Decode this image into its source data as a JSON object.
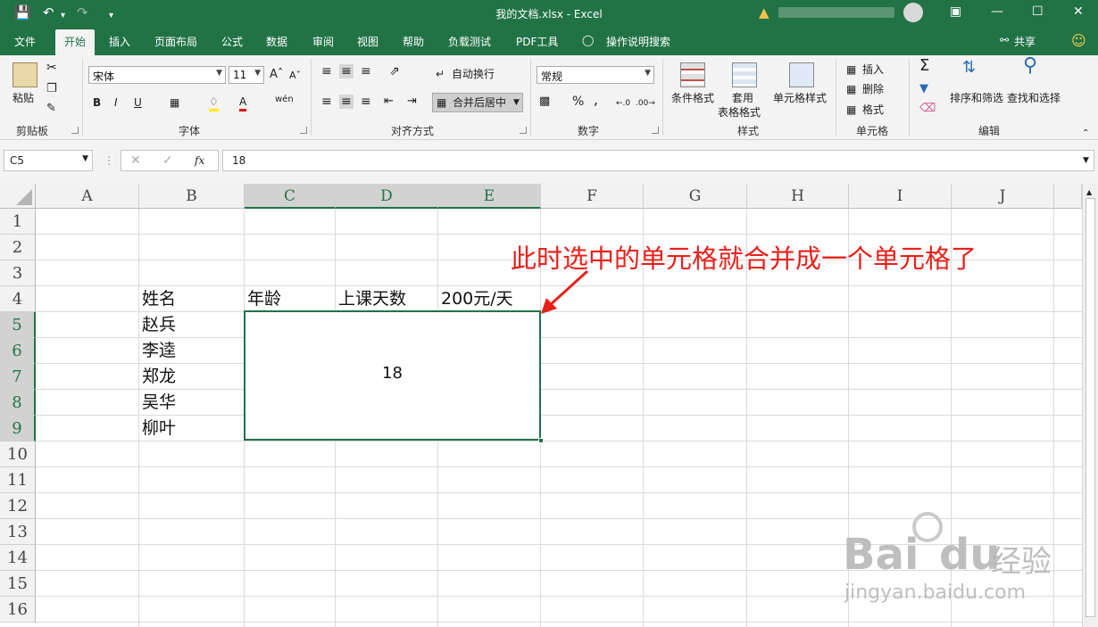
{
  "titlebar": {
    "document_title": "我的文档.xlsx - Excel",
    "quick_access": [
      "save-icon",
      "undo-icon",
      "redo-icon",
      "customize-icon"
    ]
  },
  "tabs": [
    "文件",
    "开始",
    "插入",
    "页面布局",
    "公式",
    "数据",
    "审阅",
    "视图",
    "帮助",
    "负载测试",
    "PDF工具",
    "操作说明搜索",
    "共享"
  ],
  "active_tab": "开始",
  "ribbon": {
    "clipboard": {
      "paste": "粘贴",
      "group": "剪贴板"
    },
    "font": {
      "name": "宋体",
      "size": "11",
      "group": "字体",
      "bold": "B",
      "italic": "I",
      "underline": "U",
      "phonetic": "wén"
    },
    "alignment": {
      "wrap": "自动换行",
      "merge": "合并后居中",
      "group": "对齐方式"
    },
    "number": {
      "format": "常规",
      "percent": "%",
      "comma": ",",
      "group": "数字"
    },
    "styles": {
      "conditional": "条件格式",
      "table1": "套用",
      "table2": "表格格式",
      "cell": "单元格样式",
      "group": "样式"
    },
    "cells": {
      "insert": "插入",
      "delete": "删除",
      "format": "格式",
      "group": "单元格"
    },
    "editing": {
      "sort": "排序和筛选",
      "find": "查找和选择",
      "group": "编辑"
    }
  },
  "formula_bar": {
    "name_box": "C5",
    "formula": "18",
    "fx": "fx"
  },
  "columns": [
    "A",
    "B",
    "C",
    "D",
    "E",
    "F",
    "G",
    "H",
    "I",
    "J"
  ],
  "selected_columns": [
    "C",
    "D",
    "E"
  ],
  "rows": [
    "1",
    "2",
    "3",
    "4",
    "5",
    "6",
    "7",
    "8",
    "9",
    "10",
    "11",
    "12",
    "13",
    "14",
    "15",
    "16"
  ],
  "selected_rows": [
    "5",
    "6",
    "7",
    "8",
    "9"
  ],
  "cells": {
    "B4": "姓名",
    "C4": "年龄",
    "D4": "上课天数",
    "E4": "200元/天",
    "B5": "赵兵",
    "B6": "李逵",
    "B7": "郑龙",
    "B8": "吴华",
    "B9": "柳叶",
    "merged": "18"
  },
  "annotation": "此时选中的单元格就合并成一个单元格了",
  "watermark": {
    "brand": "Bai",
    "brand2": "du",
    "brand3": "经验",
    "url": "jingyan.baidu.com"
  },
  "colors": {
    "excel_green": "#217346",
    "annotation_red": "#e8201a"
  }
}
